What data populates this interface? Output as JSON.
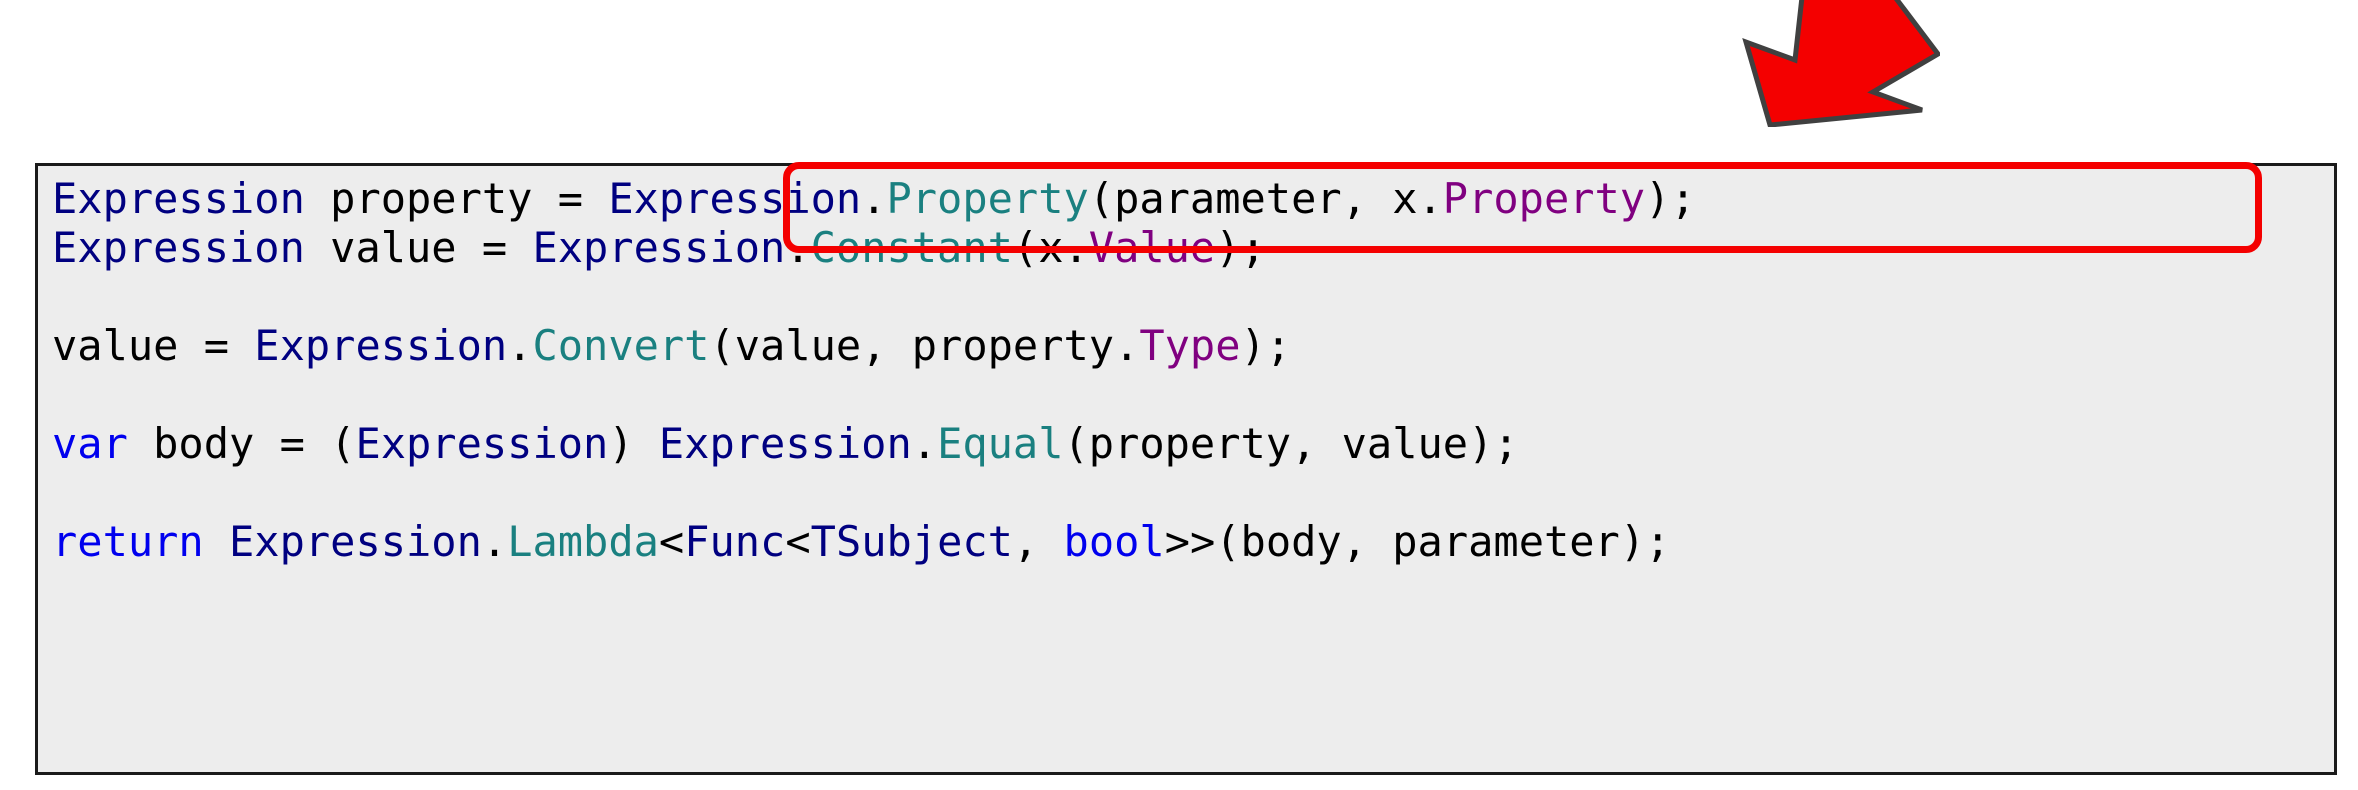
{
  "document": {
    "kind": "code-snippet-screenshot",
    "background_color": "#ffffff"
  },
  "code_block": {
    "background_color": "#ededed",
    "border_color": "#1a1a1a",
    "language": "csharp",
    "plain_text": "Expression property = Expression.Property(parameter, x.Property);\nExpression value = Expression.Constant(x.Value);\n\nvalue = Expression.Convert(value, property.Type);\n\nvar body = (Expression) Expression.Equal(property, value);\n\nreturn Expression.Lambda<Func<TSubject, bool>>(body, parameter);",
    "lines": [
      {
        "id": "line-1",
        "text": "Expression property = Expression.Property(parameter, x.Property);",
        "tokens": [
          {
            "text": "Expression",
            "kind": "type"
          },
          {
            "text": " property = ",
            "kind": "plain"
          },
          {
            "text": "Expression",
            "kind": "type"
          },
          {
            "text": ".",
            "kind": "plain"
          },
          {
            "text": "Property",
            "kind": "method"
          },
          {
            "text": "(parameter, x.",
            "kind": "plain"
          },
          {
            "text": "Property",
            "kind": "prop"
          },
          {
            "text": ");",
            "kind": "plain"
          }
        ]
      },
      {
        "id": "line-2",
        "text": "Expression value = Expression.Constant(x.Value);",
        "tokens": [
          {
            "text": "Expression",
            "kind": "type"
          },
          {
            "text": " value = ",
            "kind": "plain"
          },
          {
            "text": "Expression",
            "kind": "type"
          },
          {
            "text": ".",
            "kind": "plain"
          },
          {
            "text": "Constant",
            "kind": "method"
          },
          {
            "text": "(x.",
            "kind": "plain"
          },
          {
            "text": "Value",
            "kind": "prop"
          },
          {
            "text": ");",
            "kind": "plain"
          }
        ]
      },
      {
        "id": "line-3",
        "text": "",
        "tokens": []
      },
      {
        "id": "line-4",
        "text": "value = Expression.Convert(value, property.Type);",
        "tokens": [
          {
            "text": "value = ",
            "kind": "plain"
          },
          {
            "text": "Expression",
            "kind": "type"
          },
          {
            "text": ".",
            "kind": "plain"
          },
          {
            "text": "Convert",
            "kind": "method"
          },
          {
            "text": "(value, property.",
            "kind": "plain"
          },
          {
            "text": "Type",
            "kind": "prop"
          },
          {
            "text": ");",
            "kind": "plain"
          }
        ]
      },
      {
        "id": "line-5",
        "text": "",
        "tokens": []
      },
      {
        "id": "line-6",
        "text": "var body = (Expression) Expression.Equal(property, value);",
        "tokens": [
          {
            "text": "var",
            "kind": "keyword"
          },
          {
            "text": " body = (",
            "kind": "plain"
          },
          {
            "text": "Expression",
            "kind": "type"
          },
          {
            "text": ") ",
            "kind": "plain"
          },
          {
            "text": "Expression",
            "kind": "type"
          },
          {
            "text": ".",
            "kind": "plain"
          },
          {
            "text": "Equal",
            "kind": "method"
          },
          {
            "text": "(property, value);",
            "kind": "plain"
          }
        ]
      },
      {
        "id": "line-7",
        "text": "",
        "tokens": []
      },
      {
        "id": "line-8",
        "text": "return Expression.Lambda<Func<TSubject, bool>>(body, parameter);",
        "tokens": [
          {
            "text": "return",
            "kind": "keyword"
          },
          {
            "text": " ",
            "kind": "plain"
          },
          {
            "text": "Expression",
            "kind": "type"
          },
          {
            "text": ".",
            "kind": "plain"
          },
          {
            "text": "Lambda",
            "kind": "method"
          },
          {
            "text": "<",
            "kind": "plain"
          },
          {
            "text": "Func",
            "kind": "type"
          },
          {
            "text": "<",
            "kind": "plain"
          },
          {
            "text": "TSubject",
            "kind": "type"
          },
          {
            "text": ", ",
            "kind": "plain"
          },
          {
            "text": "bool",
            "kind": "keyword"
          },
          {
            "text": ">>(body, parameter);",
            "kind": "plain"
          }
        ]
      }
    ]
  },
  "annotations": {
    "highlight_box": {
      "name": "red-highlight-rectangle",
      "target_text": "Expression.Property(parameter, x.Property);",
      "color": "#f40000",
      "stroke_width": 7,
      "corner_radius": 16
    },
    "arrow": {
      "name": "red-arrow",
      "direction": "down-left",
      "fill_color": "#f40000",
      "outline_color": "#404040"
    }
  },
  "syntax_colors": {
    "type": "#000080",
    "keyword": "#0000ee",
    "method": "#1a8080",
    "property": "#800080",
    "plain": "#000000"
  }
}
